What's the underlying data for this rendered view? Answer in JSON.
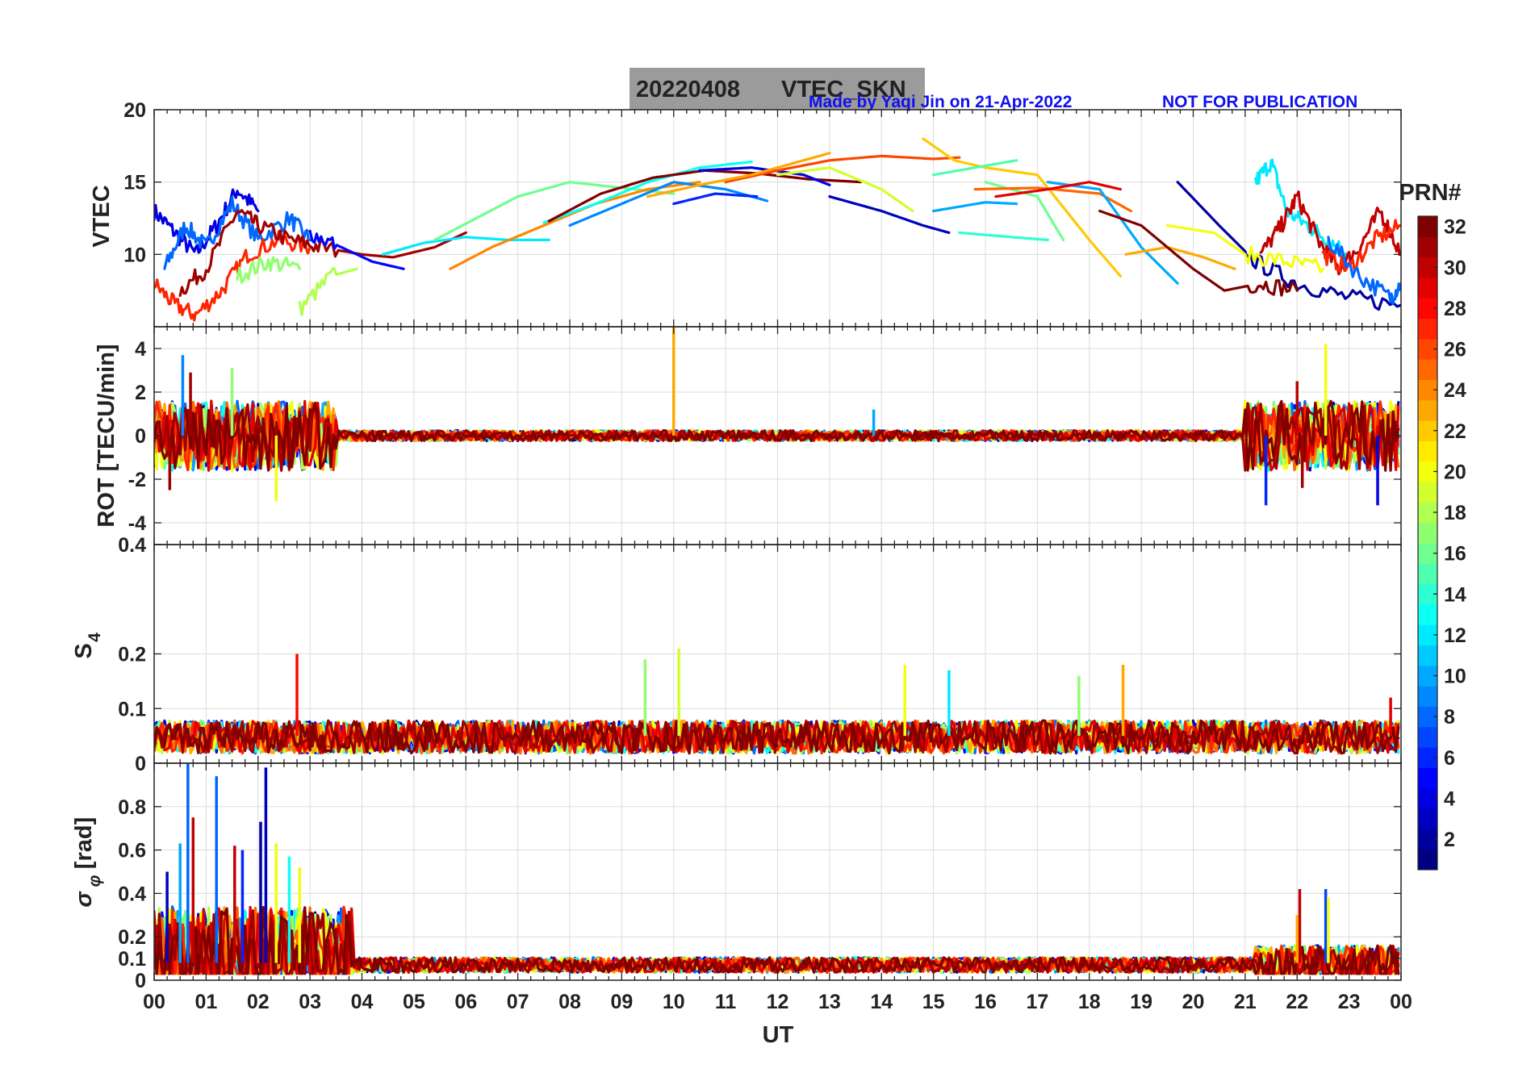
{
  "header": {
    "title_date": "20220408",
    "title_label": "VTEC_SKN",
    "credit": "Made by Yaqi Jin on 21-Apr-2022",
    "notice": "NOT FOR PUBLICATION"
  },
  "chart_data": [
    {
      "type": "line",
      "panel": "vtec",
      "ylabel": "VTEC",
      "ylim": [
        5,
        20
      ],
      "yticks": [
        10,
        15,
        20
      ],
      "xlim": [
        0,
        24
      ],
      "grid": true,
      "series": [
        {
          "prn": 4,
          "x": [
            0,
            0.4,
            0.8,
            1.2,
            1.6,
            2.0
          ],
          "y": [
            13,
            11.5,
            10,
            12,
            14.5,
            13
          ]
        },
        {
          "prn": 8,
          "x": [
            0.2,
            0.6,
            1.0,
            1.5,
            2.0,
            2.6,
            3.0
          ],
          "y": [
            9,
            12,
            10.5,
            13.5,
            11,
            12.5,
            11
          ]
        },
        {
          "prn": 27,
          "x": [
            0,
            0.4,
            0.8,
            1.3,
            1.8,
            2.4,
            3.0
          ],
          "y": [
            8,
            6.5,
            5.8,
            7.5,
            10,
            11,
            10.5
          ]
        },
        {
          "prn": 31,
          "x": [
            0.5,
            1.0,
            1.6,
            2.0,
            2.6,
            3.2,
            4.0,
            4.6,
            5.4,
            6.0
          ],
          "y": [
            7.5,
            9,
            13,
            12,
            11,
            10.5,
            10,
            9.8,
            10.5,
            11.5
          ]
        },
        {
          "prn": 17,
          "x": [
            1.6,
            2.2,
            2.8
          ],
          "y": [
            8.5,
            9.5,
            9
          ]
        },
        {
          "prn": 5,
          "x": [
            3.0,
            3.6,
            4.2,
            4.8
          ],
          "y": [
            11.5,
            10.5,
            9.5,
            9
          ]
        },
        {
          "prn": 18,
          "x": [
            2.8,
            3.4,
            3.9
          ],
          "y": [
            6.2,
            8.5,
            9
          ]
        },
        {
          "prn": 12,
          "x": [
            4.4,
            5.2,
            6.0,
            6.8,
            7.6
          ],
          "y": [
            10,
            10.8,
            11.2,
            11,
            11
          ]
        },
        {
          "prn": 16,
          "x": [
            5.4,
            6.2,
            7.0,
            8.0,
            9.0,
            10.0
          ],
          "y": [
            11,
            12.5,
            14,
            15,
            14.6,
            14.2
          ]
        },
        {
          "prn": 24,
          "x": [
            5.7,
            6.5,
            7.5,
            8.5,
            9.5,
            10.5
          ],
          "y": [
            9,
            10.5,
            12,
            13.5,
            14.5,
            15
          ]
        },
        {
          "prn": 13,
          "x": [
            7.5,
            8.5,
            9.5,
            10.5,
            11.5
          ],
          "y": [
            12.2,
            13.5,
            15,
            16,
            16.4
          ]
        },
        {
          "prn": 9,
          "x": [
            8.0,
            9.0,
            10.0,
            11.0,
            11.8
          ],
          "y": [
            12,
            13.5,
            15,
            14.5,
            13.7
          ]
        },
        {
          "prn": 32,
          "x": [
            7.6,
            8.6,
            9.6,
            10.6,
            11.6,
            12.6,
            13.6
          ],
          "y": [
            12.3,
            14.2,
            15.3,
            15.8,
            15.6,
            15.2,
            15
          ]
        },
        {
          "prn": 4,
          "x": [
            10.5,
            11.5,
            12.5,
            13.0
          ],
          "y": [
            15.8,
            16,
            15.5,
            14.8
          ]
        },
        {
          "prn": 6,
          "x": [
            10.0,
            10.8,
            11.6
          ],
          "y": [
            13.5,
            14.2,
            14
          ]
        },
        {
          "prn": 26,
          "x": [
            11.0,
            12.0,
            13.0,
            14.0,
            15.0,
            15.5
          ],
          "y": [
            15,
            15.8,
            16.5,
            16.8,
            16.6,
            16.7
          ]
        },
        {
          "prn": 23,
          "x": [
            9.5,
            10.5,
            11.5,
            12.5,
            13.0
          ],
          "y": [
            14,
            14.8,
            15.5,
            16.5,
            17
          ]
        },
        {
          "prn": 19,
          "x": [
            12.0,
            13.0,
            14.0,
            14.6
          ],
          "y": [
            15.5,
            16,
            14.5,
            13
          ]
        },
        {
          "prn": 3,
          "x": [
            13.0,
            14.0,
            14.8,
            15.3
          ],
          "y": [
            14,
            13,
            12,
            11.5
          ]
        },
        {
          "prn": 22,
          "x": [
            14.8,
            15.4,
            16.0,
            17.0,
            18.0,
            18.6
          ],
          "y": [
            18,
            16.5,
            16,
            15.5,
            11,
            8.5
          ]
        },
        {
          "prn": 15,
          "x": [
            15.0,
            15.8,
            16.6
          ],
          "y": [
            15.5,
            16,
            16.5
          ]
        },
        {
          "prn": 10,
          "x": [
            15.0,
            16.0,
            16.6
          ],
          "y": [
            13,
            13.6,
            13.5
          ]
        },
        {
          "prn": 16,
          "x": [
            16.0,
            17.0,
            17.5
          ],
          "y": [
            15,
            14,
            11
          ]
        },
        {
          "prn": 14,
          "x": [
            15.5,
            16.5,
            17.2
          ],
          "y": [
            11.5,
            11.2,
            11
          ]
        },
        {
          "prn": 25,
          "x": [
            15.8,
            17.0,
            18.2,
            18.8
          ],
          "y": [
            14.5,
            14.6,
            14.2,
            13
          ]
        },
        {
          "prn": 10,
          "x": [
            17.2,
            18.2,
            19.0,
            19.7
          ],
          "y": [
            15,
            14.5,
            10.5,
            8
          ]
        },
        {
          "prn": 29,
          "x": [
            16.2,
            17.2,
            18.0,
            18.6
          ],
          "y": [
            14,
            14.5,
            15,
            14.5
          ]
        },
        {
          "prn": 2,
          "x": [
            19.7,
            20.5,
            21.2,
            22.0,
            23.0,
            24.0
          ],
          "y": [
            15,
            12,
            9.5,
            8,
            7,
            6.5
          ]
        },
        {
          "prn": 23,
          "x": [
            18.7,
            19.5,
            20.2,
            20.8
          ],
          "y": [
            10,
            10.5,
            9.8,
            9
          ]
        },
        {
          "prn": 32,
          "x": [
            18.2,
            19.0,
            20.0,
            20.6,
            21.3,
            22.0
          ],
          "y": [
            13,
            12,
            9,
            7.5,
            8,
            7.5
          ]
        },
        {
          "prn": 20,
          "x": [
            19.5,
            20.4,
            21.0,
            21.8,
            22.5
          ],
          "y": [
            12,
            11.5,
            10,
            9.5,
            9
          ]
        },
        {
          "prn": 12,
          "x": [
            21.2,
            21.5,
            21.8,
            22.2,
            22.6,
            23.0
          ],
          "y": [
            15,
            16.4,
            13,
            12,
            11,
            10
          ]
        },
        {
          "prn": 30,
          "x": [
            21.3,
            21.7,
            22.0,
            22.4,
            22.8,
            23.2,
            23.6,
            24.0
          ],
          "y": [
            10,
            12,
            14,
            11,
            9,
            10.5,
            13,
            10
          ]
        },
        {
          "prn": 27,
          "x": [
            22.5,
            23.0,
            23.5,
            24.0
          ],
          "y": [
            10,
            9,
            11,
            12
          ]
        },
        {
          "prn": 8,
          "x": [
            22.6,
            23.2,
            23.8,
            24.0
          ],
          "y": [
            11,
            8.5,
            7,
            8
          ]
        }
      ]
    },
    {
      "type": "line",
      "panel": "rot",
      "ylabel": "ROT [TECU/min]",
      "ylim": [
        -5,
        5
      ],
      "yticks": [
        -4,
        -2,
        0,
        2,
        4
      ],
      "xlim": [
        0,
        24
      ],
      "grid": true,
      "spikes": [
        {
          "x": 10.0,
          "y": 5.0,
          "prn": 23
        },
        {
          "x": 0.55,
          "y": 3.7,
          "prn": 9
        },
        {
          "x": 0.7,
          "y": 2.9,
          "prn": 31
        },
        {
          "x": 1.5,
          "y": 3.1,
          "prn": 17
        },
        {
          "x": 2.35,
          "y": -3.0,
          "prn": 20
        },
        {
          "x": 0.3,
          "y": -2.5,
          "prn": 31
        },
        {
          "x": 22.55,
          "y": 4.2,
          "prn": 20
        },
        {
          "x": 22.0,
          "y": 2.5,
          "prn": 30
        },
        {
          "x": 21.4,
          "y": -3.2,
          "prn": 6
        },
        {
          "x": 23.55,
          "y": -3.2,
          "prn": 4
        },
        {
          "x": 22.1,
          "y": -2.4,
          "prn": 31
        },
        {
          "x": 13.85,
          "y": 1.2,
          "prn": 10
        }
      ]
    },
    {
      "type": "line",
      "panel": "s4",
      "ylabel": "S4",
      "ylim": [
        0,
        0.4
      ],
      "yticks": [
        0,
        0.1,
        0.2,
        0.4
      ],
      "xlim": [
        0,
        24
      ],
      "grid": true,
      "spikes": [
        {
          "x": 2.75,
          "y": 0.2,
          "prn": 28
        },
        {
          "x": 9.45,
          "y": 0.19,
          "prn": 17
        },
        {
          "x": 10.1,
          "y": 0.21,
          "prn": 19
        },
        {
          "x": 14.45,
          "y": 0.18,
          "prn": 20
        },
        {
          "x": 15.3,
          "y": 0.17,
          "prn": 12
        },
        {
          "x": 17.8,
          "y": 0.16,
          "prn": 17
        },
        {
          "x": 18.65,
          "y": 0.18,
          "prn": 23
        },
        {
          "x": 23.8,
          "y": 0.12,
          "prn": 29
        }
      ]
    },
    {
      "type": "line",
      "panel": "sigma_phi",
      "ylabel": "σφ [rad]",
      "ylim": [
        0,
        1
      ],
      "yticks": [
        0,
        0.1,
        0.2,
        0.4,
        0.6,
        0.8
      ],
      "xlim": [
        0,
        24
      ],
      "xlabel": "UT",
      "xticks": [
        "00",
        "01",
        "02",
        "03",
        "04",
        "05",
        "06",
        "07",
        "08",
        "09",
        "10",
        "11",
        "12",
        "13",
        "14",
        "15",
        "16",
        "17",
        "18",
        "19",
        "20",
        "21",
        "22",
        "23",
        "00"
      ],
      "grid": true,
      "spikes": [
        {
          "x": 0.65,
          "y": 1.0,
          "prn": 8
        },
        {
          "x": 0.75,
          "y": 0.75,
          "prn": 30
        },
        {
          "x": 1.2,
          "y": 0.94,
          "prn": 8
        },
        {
          "x": 0.25,
          "y": 0.5,
          "prn": 3
        },
        {
          "x": 0.5,
          "y": 0.63,
          "prn": 10
        },
        {
          "x": 1.7,
          "y": 0.6,
          "prn": 6
        },
        {
          "x": 2.05,
          "y": 0.73,
          "prn": 2
        },
        {
          "x": 2.15,
          "y": 0.98,
          "prn": 3
        },
        {
          "x": 2.35,
          "y": 0.63,
          "prn": 20
        },
        {
          "x": 2.6,
          "y": 0.57,
          "prn": 13
        },
        {
          "x": 1.55,
          "y": 0.62,
          "prn": 30
        },
        {
          "x": 2.8,
          "y": 0.52,
          "prn": 20
        },
        {
          "x": 22.05,
          "y": 0.42,
          "prn": 30
        },
        {
          "x": 22.55,
          "y": 0.42,
          "prn": 7
        },
        {
          "x": 22.6,
          "y": 0.38,
          "prn": 20
        },
        {
          "x": 22.0,
          "y": 0.3,
          "prn": 23
        }
      ]
    }
  ],
  "colorbar": {
    "title": "PRN#",
    "range": [
      1,
      32
    ],
    "ticks": [
      2,
      4,
      6,
      8,
      10,
      12,
      14,
      16,
      18,
      20,
      22,
      24,
      26,
      28,
      30,
      32
    ],
    "colormap": "jet"
  }
}
